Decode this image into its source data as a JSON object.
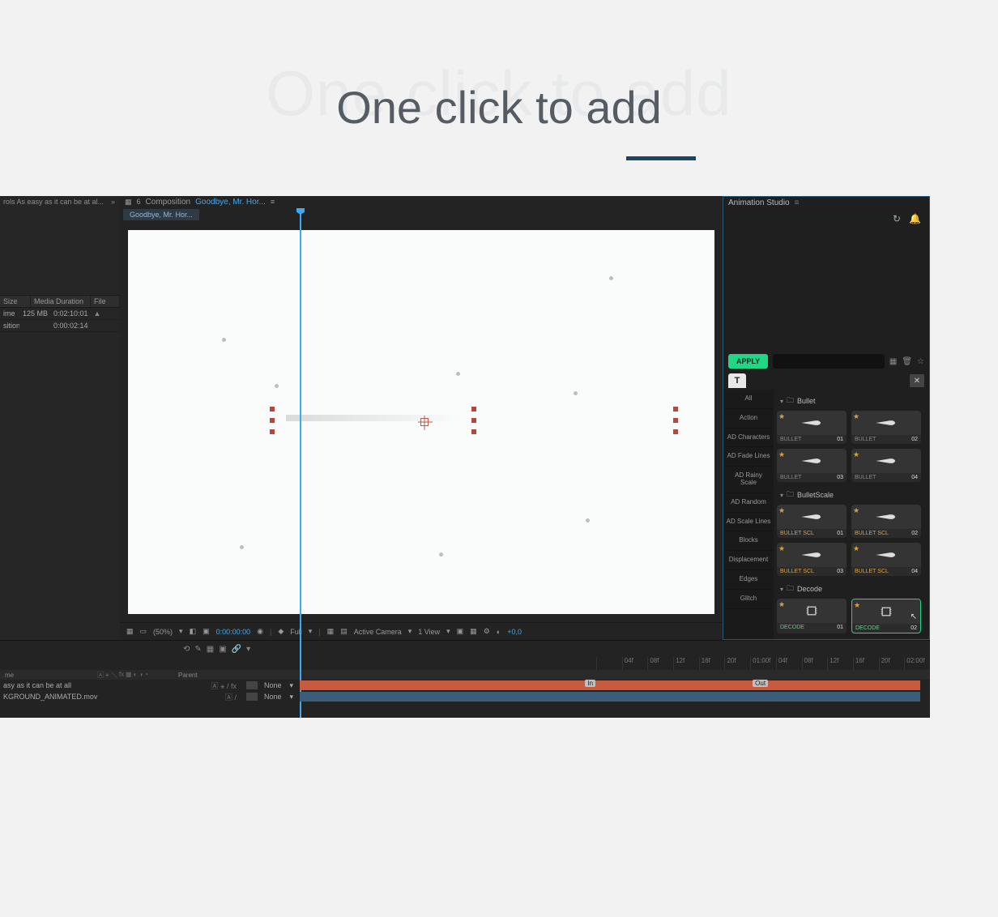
{
  "hero": {
    "ghost": "One click to add",
    "title": "One click to add"
  },
  "project": {
    "header": "rols As easy as it can be at al...",
    "columns": {
      "size": "Size",
      "mediaDuration": "Media Duration",
      "file": "File"
    },
    "rows": [
      {
        "name": "ime",
        "size": "125 MB",
        "duration": "0:02:10:01",
        "icon": "▲"
      },
      {
        "name": "sition",
        "size": "",
        "duration": "0:00:02:14",
        "icon": ""
      }
    ]
  },
  "comp": {
    "panelLabel": "Composition",
    "compName": "Goodbye, Mr. Hor...",
    "subtab": "Goodbye, Mr. Hor..."
  },
  "viewerToolbar": {
    "zoom": "(50%)",
    "time": "0:00:00:00",
    "res": "Full",
    "cam": "Active Camera",
    "view": "1 View",
    "offset": "+0,0"
  },
  "animPanel": {
    "title": "Animation Studio",
    "apply": "APPLY",
    "categories": [
      "All",
      "Action",
      "AD Characters",
      "AD Fade Lines",
      "AD Rainy Scale",
      "AD Random",
      "AD Scale Lines",
      "Blocks",
      "Displacement",
      "Edges",
      "Glitch"
    ],
    "folders": [
      {
        "name": "Bullet",
        "presets": [
          {
            "label": "BULLET",
            "num": "01"
          },
          {
            "label": "BULLET",
            "num": "02"
          },
          {
            "label": "BULLET",
            "num": "03"
          },
          {
            "label": "BULLET",
            "num": "04"
          }
        ]
      },
      {
        "name": "BulletScale",
        "labelClass": "yellow-label",
        "presets": [
          {
            "label": "BULLET SCL",
            "num": "01"
          },
          {
            "label": "BULLET SCL",
            "num": "02"
          },
          {
            "label": "BULLET SCL",
            "num": "03"
          },
          {
            "label": "BULLET SCL",
            "num": "04"
          }
        ]
      },
      {
        "name": "Decode",
        "labelClass": "green-label",
        "presets": [
          {
            "label": "DECODE",
            "num": "01"
          },
          {
            "label": "DECODE",
            "num": "02",
            "selected": true
          }
        ]
      }
    ]
  },
  "timeline": {
    "ticks": [
      "",
      "04f",
      "08f",
      "12f",
      "16f",
      "20f",
      "01:00f",
      "04f",
      "08f",
      "12f",
      "16f",
      "20f",
      "02:00f"
    ],
    "colLabels": {
      "name": "me",
      "parent": "Parent"
    },
    "parentNone": "None",
    "layers": [
      {
        "name": "asy as it can be at all",
        "bar": "red",
        "in": "In",
        "out": "Out"
      },
      {
        "name": "KGROUND_ANIMATED.mov",
        "bar": "blue"
      }
    ]
  }
}
